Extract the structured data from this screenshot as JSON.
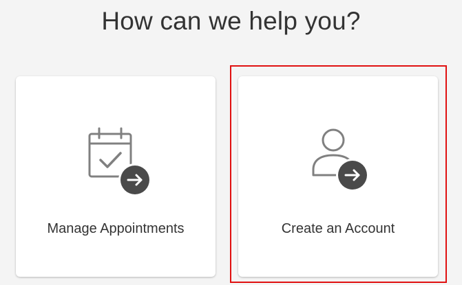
{
  "header": {
    "title": "How can we help you?"
  },
  "cards": [
    {
      "label": "Manage Appointments",
      "icon": "calendar-check-icon"
    },
    {
      "label": "Create an Account",
      "icon": "user-add-icon"
    }
  ],
  "overlay": {
    "highlight_color": "#e01010",
    "highlighted_card": "Create an Account"
  },
  "colors": {
    "background": "#f4f4f4",
    "card": "#ffffff",
    "text": "#333333",
    "icon_outline": "#808080",
    "arrow_badge": "#4a4a4a"
  }
}
